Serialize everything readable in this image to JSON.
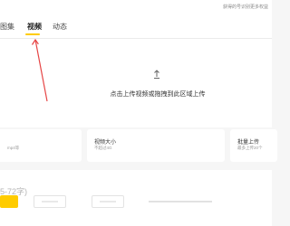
{
  "tabs": {
    "gallery": "图集",
    "video": "视频",
    "dynamic": "动态"
  },
  "hint": "获得的号识别更多权益",
  "upload": {
    "text": "点击上传视频或拖拽到此区域上传",
    "icon": "upload-arrow-icon"
  },
  "cards": [
    {
      "title": "",
      "subtitle": "mp4等"
    },
    {
      "title": "视频大小",
      "subtitle": "不超过4G"
    },
    {
      "title": "批量上传",
      "subtitle": "最多上传20个"
    }
  ],
  "title_hint": "5-72字)",
  "colors": {
    "accent": "#ffcc00",
    "annotation": "#e64545"
  }
}
